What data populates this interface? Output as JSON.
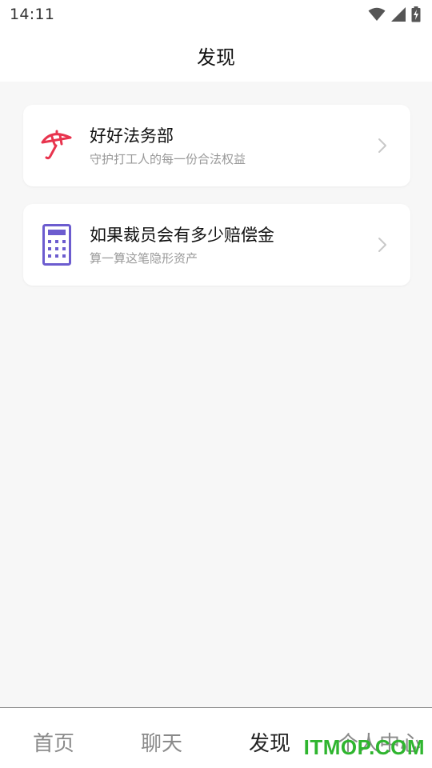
{
  "status_bar": {
    "time": "14:11"
  },
  "header": {
    "title": "发现"
  },
  "cards": [
    {
      "title": "好好法务部",
      "subtitle": "守护打工人的每一份合法权益",
      "icon": "umbrella-icon",
      "icon_color": "#e8344e"
    },
    {
      "title": "如果裁员会有多少赔偿金",
      "subtitle": "算一算这笔隐形资产",
      "icon": "calculator-icon",
      "icon_color": "#6c5ccf"
    }
  ],
  "tabbar": {
    "tabs": [
      {
        "label": "首页",
        "active": false
      },
      {
        "label": "聊天",
        "active": false
      },
      {
        "label": "发现",
        "active": true
      },
      {
        "label": "个人中心",
        "active": false
      }
    ]
  },
  "watermark": "ITMOP.COM"
}
